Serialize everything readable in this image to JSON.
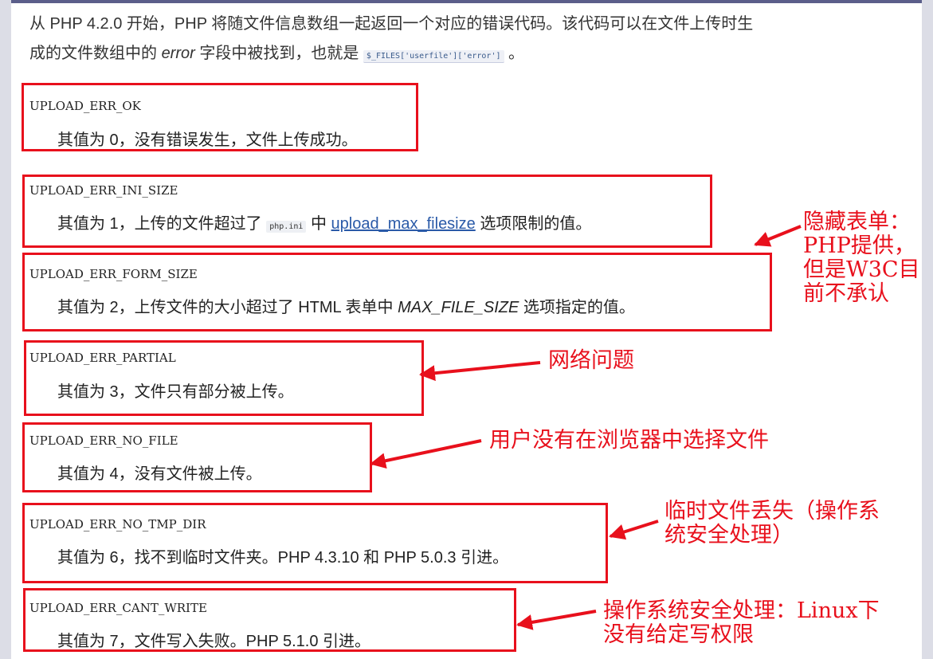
{
  "intro": {
    "line1": "从 PHP 4.2.0 开始，PHP 将随文件信息数组一起返回一个对应的错误代码。该代码可以在文件上传时生",
    "line2_pre": "成的文件数组中的 ",
    "line2_em": "error",
    "line2_mid": " 字段中被找到，也就是 ",
    "line2_code": "$_FILES['userfile']['error']",
    "line2_post": " 。"
  },
  "errors": [
    {
      "name": "UPLOAD_ERR_OK",
      "desc": "其值为 0，没有错误发生，文件上传成功。"
    },
    {
      "name": "UPLOAD_ERR_INI_SIZE",
      "desc_pre": "其值为 1，上传的文件超过了 ",
      "desc_code": "php.ini",
      "desc_mid": " 中 ",
      "desc_link": "upload_max_filesize",
      "desc_post": " 选项限制的值。"
    },
    {
      "name": "UPLOAD_ERR_FORM_SIZE",
      "desc_pre": "其值为 2，上传文件的大小超过了 HTML 表单中 ",
      "desc_em": "MAX_FILE_SIZE",
      "desc_post": " 选项指定的值。"
    },
    {
      "name": "UPLOAD_ERR_PARTIAL",
      "desc": "其值为 3，文件只有部分被上传。"
    },
    {
      "name": "UPLOAD_ERR_NO_FILE",
      "desc": "其值为 4，没有文件被上传。"
    },
    {
      "name": "UPLOAD_ERR_NO_TMP_DIR",
      "desc": "其值为 6，找不到临时文件夹。PHP 4.3.10 和 PHP 5.0.3 引进。"
    },
    {
      "name": "UPLOAD_ERR_CANT_WRITE",
      "desc": "其值为 7，文件写入失败。PHP 5.1.0 引进。"
    }
  ],
  "annotations": {
    "form_size": [
      "隐藏表单：",
      "PHP提供，",
      "但是W3C目",
      "前不承认"
    ],
    "partial": [
      "网络问题"
    ],
    "no_file": [
      "用户没有在浏览器中选择文件"
    ],
    "no_tmp_dir": [
      "临时文件丢失（操作系",
      "统安全处理）"
    ],
    "cant_write": [
      "操作系统安全处理：Linux下",
      "没有给定写权限"
    ]
  },
  "colors": {
    "annotation": "#e8101c",
    "link": "#2a5aa8",
    "text": "#222222"
  }
}
